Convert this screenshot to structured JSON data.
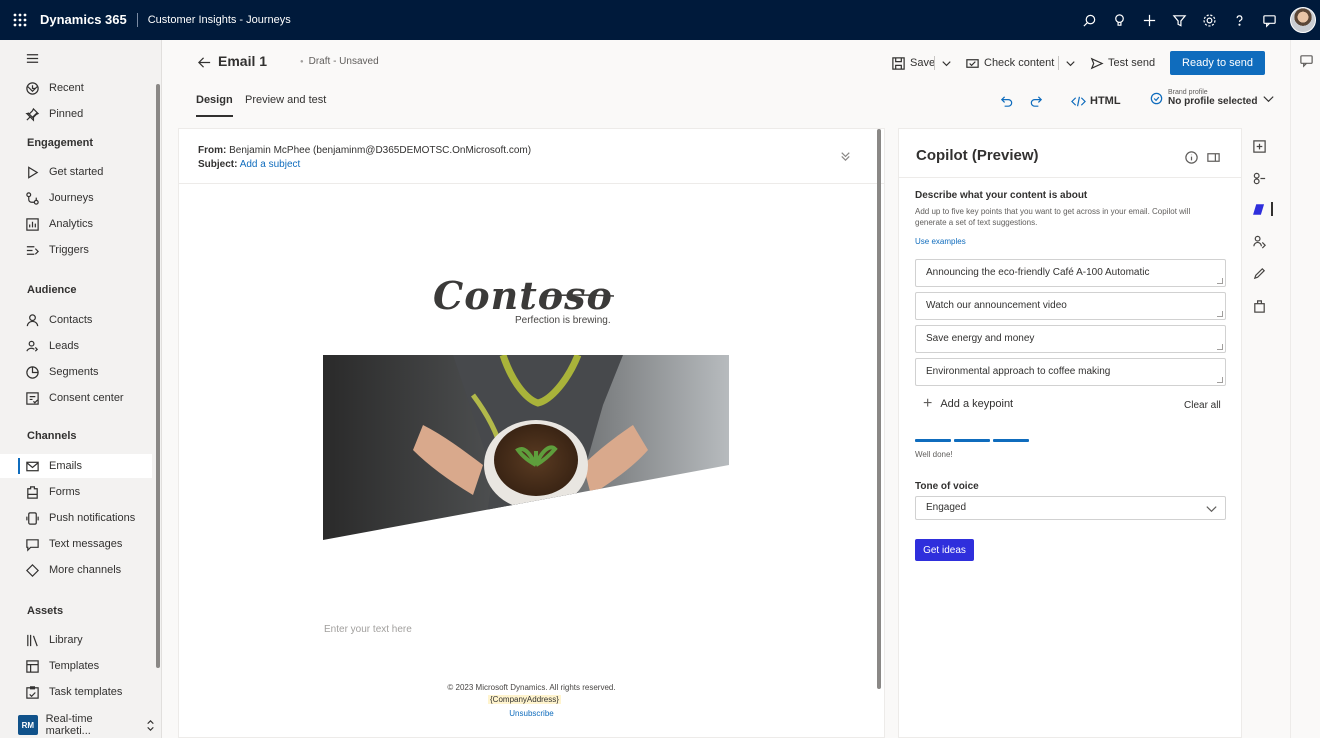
{
  "topbar": {
    "app_name": "Dynamics 365",
    "area_name": "Customer Insights - Journeys",
    "tools": [
      "search-icon",
      "lightbulb-icon",
      "plus-icon",
      "filter-icon",
      "gear-icon",
      "help-icon",
      "chat-icon"
    ]
  },
  "nav": {
    "recent": "Recent",
    "pinned": "Pinned",
    "sections": {
      "engagement": "Engagement",
      "audience": "Audience",
      "channels": "Channels",
      "assets": "Assets"
    },
    "engagement_items": [
      "Get started",
      "Journeys",
      "Analytics",
      "Triggers"
    ],
    "audience_items": [
      "Contacts",
      "Leads",
      "Segments",
      "Consent center"
    ],
    "channel_items": [
      "Emails",
      "Forms",
      "Push notifications",
      "Text messages",
      "More channels"
    ],
    "asset_items": [
      "Library",
      "Templates",
      "Task templates"
    ],
    "selected": "Emails",
    "area": {
      "badge": "RM",
      "label": "Real-time marketi..."
    }
  },
  "command": {
    "title": "Email 1",
    "status": "Draft - Unsaved",
    "save": "Save",
    "check_content": "Check content",
    "test_send": "Test send",
    "ready_to_send": "Ready to send"
  },
  "tabs": {
    "design": "Design",
    "preview": "Preview and test",
    "html": "HTML",
    "brand_label": "Brand profile",
    "brand_value": "No profile selected"
  },
  "email": {
    "from_label": "From:",
    "from_value": "Benjamin McPhee (benjaminm@D365DEMOTSC.OnMicrosoft.com)",
    "subject_label": "Subject:",
    "subject_value": "Add a subject",
    "logo": "Contoso",
    "tagline": "Perfection is brewing.",
    "text_placeholder": "Enter your text here",
    "copyright": "© 2023 Microsoft Dynamics. All rights reserved.",
    "address": "{CompanyAddress}",
    "unsubscribe": "Unsubscribe"
  },
  "copilot": {
    "title": "Copilot (Preview)",
    "describe_heading": "Describe what your content is about",
    "describe_text": "Add up to five key points that you want to get across in your email. Copilot will generate a set of text suggestions.",
    "use_examples": "Use examples",
    "keypoints": [
      "Announcing the eco-friendly Café A-100 Automatic",
      "Watch our announcement video",
      "Save energy and money",
      "Environmental approach to coffee making"
    ],
    "add_keypoint": "Add a keypoint",
    "clear_all": "Clear all",
    "progress_text": "Well done!",
    "tone_label": "Tone of voice",
    "tone_value": "Engaged",
    "get_ideas": "Get ideas"
  },
  "colors": {
    "topbar": "#001a3b",
    "accent": "#0f6cbd",
    "copilot_button": "#2f2fdc"
  }
}
